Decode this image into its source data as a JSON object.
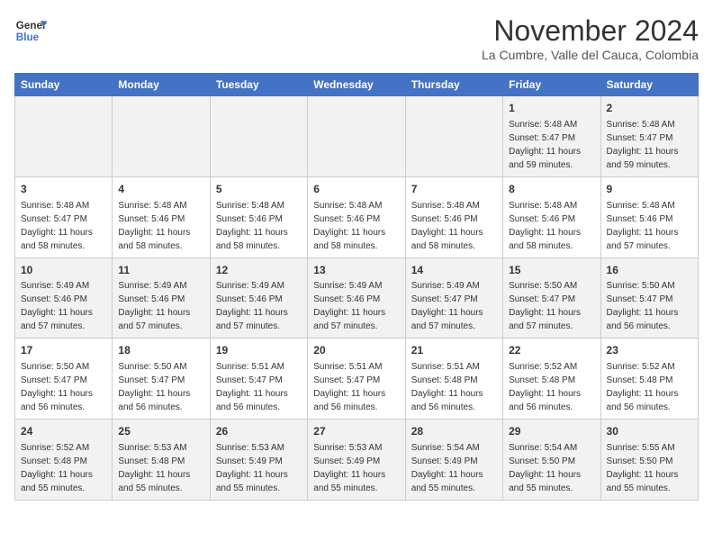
{
  "header": {
    "logo_line1": "General",
    "logo_line2": "Blue",
    "month_title": "November 2024",
    "location": "La Cumbre, Valle del Cauca, Colombia"
  },
  "days_of_week": [
    "Sunday",
    "Monday",
    "Tuesday",
    "Wednesday",
    "Thursday",
    "Friday",
    "Saturday"
  ],
  "weeks": [
    [
      {
        "day": "",
        "info": ""
      },
      {
        "day": "",
        "info": ""
      },
      {
        "day": "",
        "info": ""
      },
      {
        "day": "",
        "info": ""
      },
      {
        "day": "",
        "info": ""
      },
      {
        "day": "1",
        "info": "Sunrise: 5:48 AM\nSunset: 5:47 PM\nDaylight: 11 hours and 59 minutes."
      },
      {
        "day": "2",
        "info": "Sunrise: 5:48 AM\nSunset: 5:47 PM\nDaylight: 11 hours and 59 minutes."
      }
    ],
    [
      {
        "day": "3",
        "info": "Sunrise: 5:48 AM\nSunset: 5:47 PM\nDaylight: 11 hours and 58 minutes."
      },
      {
        "day": "4",
        "info": "Sunrise: 5:48 AM\nSunset: 5:46 PM\nDaylight: 11 hours and 58 minutes."
      },
      {
        "day": "5",
        "info": "Sunrise: 5:48 AM\nSunset: 5:46 PM\nDaylight: 11 hours and 58 minutes."
      },
      {
        "day": "6",
        "info": "Sunrise: 5:48 AM\nSunset: 5:46 PM\nDaylight: 11 hours and 58 minutes."
      },
      {
        "day": "7",
        "info": "Sunrise: 5:48 AM\nSunset: 5:46 PM\nDaylight: 11 hours and 58 minutes."
      },
      {
        "day": "8",
        "info": "Sunrise: 5:48 AM\nSunset: 5:46 PM\nDaylight: 11 hours and 58 minutes."
      },
      {
        "day": "9",
        "info": "Sunrise: 5:48 AM\nSunset: 5:46 PM\nDaylight: 11 hours and 57 minutes."
      }
    ],
    [
      {
        "day": "10",
        "info": "Sunrise: 5:49 AM\nSunset: 5:46 PM\nDaylight: 11 hours and 57 minutes."
      },
      {
        "day": "11",
        "info": "Sunrise: 5:49 AM\nSunset: 5:46 PM\nDaylight: 11 hours and 57 minutes."
      },
      {
        "day": "12",
        "info": "Sunrise: 5:49 AM\nSunset: 5:46 PM\nDaylight: 11 hours and 57 minutes."
      },
      {
        "day": "13",
        "info": "Sunrise: 5:49 AM\nSunset: 5:46 PM\nDaylight: 11 hours and 57 minutes."
      },
      {
        "day": "14",
        "info": "Sunrise: 5:49 AM\nSunset: 5:47 PM\nDaylight: 11 hours and 57 minutes."
      },
      {
        "day": "15",
        "info": "Sunrise: 5:50 AM\nSunset: 5:47 PM\nDaylight: 11 hours and 57 minutes."
      },
      {
        "day": "16",
        "info": "Sunrise: 5:50 AM\nSunset: 5:47 PM\nDaylight: 11 hours and 56 minutes."
      }
    ],
    [
      {
        "day": "17",
        "info": "Sunrise: 5:50 AM\nSunset: 5:47 PM\nDaylight: 11 hours and 56 minutes."
      },
      {
        "day": "18",
        "info": "Sunrise: 5:50 AM\nSunset: 5:47 PM\nDaylight: 11 hours and 56 minutes."
      },
      {
        "day": "19",
        "info": "Sunrise: 5:51 AM\nSunset: 5:47 PM\nDaylight: 11 hours and 56 minutes."
      },
      {
        "day": "20",
        "info": "Sunrise: 5:51 AM\nSunset: 5:47 PM\nDaylight: 11 hours and 56 minutes."
      },
      {
        "day": "21",
        "info": "Sunrise: 5:51 AM\nSunset: 5:48 PM\nDaylight: 11 hours and 56 minutes."
      },
      {
        "day": "22",
        "info": "Sunrise: 5:52 AM\nSunset: 5:48 PM\nDaylight: 11 hours and 56 minutes."
      },
      {
        "day": "23",
        "info": "Sunrise: 5:52 AM\nSunset: 5:48 PM\nDaylight: 11 hours and 56 minutes."
      }
    ],
    [
      {
        "day": "24",
        "info": "Sunrise: 5:52 AM\nSunset: 5:48 PM\nDaylight: 11 hours and 55 minutes."
      },
      {
        "day": "25",
        "info": "Sunrise: 5:53 AM\nSunset: 5:48 PM\nDaylight: 11 hours and 55 minutes."
      },
      {
        "day": "26",
        "info": "Sunrise: 5:53 AM\nSunset: 5:49 PM\nDaylight: 11 hours and 55 minutes."
      },
      {
        "day": "27",
        "info": "Sunrise: 5:53 AM\nSunset: 5:49 PM\nDaylight: 11 hours and 55 minutes."
      },
      {
        "day": "28",
        "info": "Sunrise: 5:54 AM\nSunset: 5:49 PM\nDaylight: 11 hours and 55 minutes."
      },
      {
        "day": "29",
        "info": "Sunrise: 5:54 AM\nSunset: 5:50 PM\nDaylight: 11 hours and 55 minutes."
      },
      {
        "day": "30",
        "info": "Sunrise: 5:55 AM\nSunset: 5:50 PM\nDaylight: 11 hours and 55 minutes."
      }
    ]
  ]
}
